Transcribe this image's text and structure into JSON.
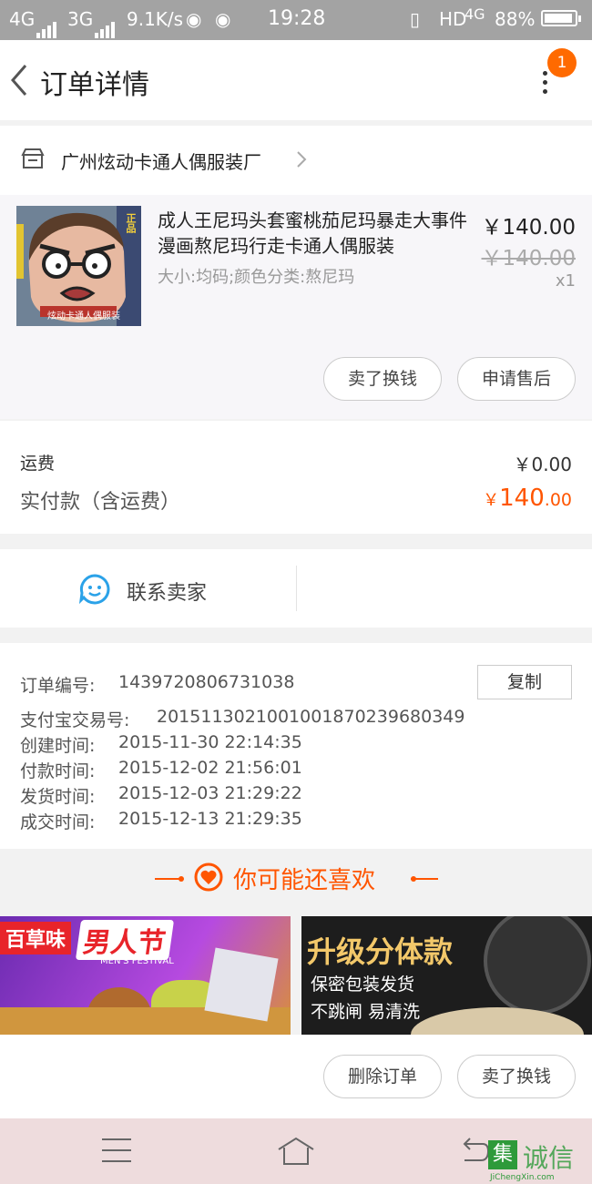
{
  "status_bar": {
    "net1": "4G",
    "net2": "3G",
    "speed": "9.1K/s",
    "time": "19:28",
    "hd": "HD",
    "net3": "4G",
    "battery": "88%"
  },
  "header": {
    "title": "订单详情",
    "badge": "1"
  },
  "shop": {
    "name": "广州炫动卡通人偶服装厂"
  },
  "item": {
    "title": "成人王尼玛头套蜜桃茄尼玛暴走大事件漫画熬尼玛行走卡通人偶服装",
    "spec": "大小:均码;颜色分类:熬尼玛",
    "price": "￥140.00",
    "original_price": "￥140.00",
    "quantity": "x1",
    "thumb_banner_text": "正品",
    "thumb_caption": "炫动卡通人偶服装"
  },
  "item_actions": {
    "sell_swap": "卖了换钱",
    "after_sale": "申请售后"
  },
  "fees": {
    "shipping_label": "运费",
    "shipping_value": "￥0.00",
    "paid_label": "实付款（含运费）",
    "paid_currency": "￥",
    "paid_int": "140",
    "paid_dec": ".00"
  },
  "contact": {
    "label": "联系卖家"
  },
  "order_info": {
    "order_no_label": "订单编号:",
    "order_no": "1439720806731038",
    "copy": "复制",
    "alipay_label": "支付宝交易号:",
    "alipay_no": "2015113021001001870239680349",
    "created_label": "创建时间:",
    "created": "2015-11-30 22:14:35",
    "paid_label": "付款时间:",
    "paid": "2015-12-02 21:56:01",
    "shipped_label": "发货时间:",
    "shipped": "2015-12-03 21:29:22",
    "done_label": "成交时间:",
    "done": "2015-12-13 21:29:35"
  },
  "recommend": {
    "title": "你可能还喜欢",
    "ad1_brand": "百草味",
    "ad1_slogan": "男人节",
    "ad1_sub": "MEN'S FESTIVAL",
    "ad2_title": "升级分体款",
    "ad2_line1": "保密包装发货",
    "ad2_line2": "不跳闸 易清洗"
  },
  "bottom_actions": {
    "delete": "删除订单",
    "sell_swap": "卖了换钱"
  },
  "watermark": {
    "brand": "诚信",
    "url": "JiChengXin.com"
  },
  "colors": {
    "accent": "#ff5500",
    "badge": "#ff6a00",
    "status_bar": "#a3a3a3",
    "contact_icon": "#2ba2e8"
  }
}
